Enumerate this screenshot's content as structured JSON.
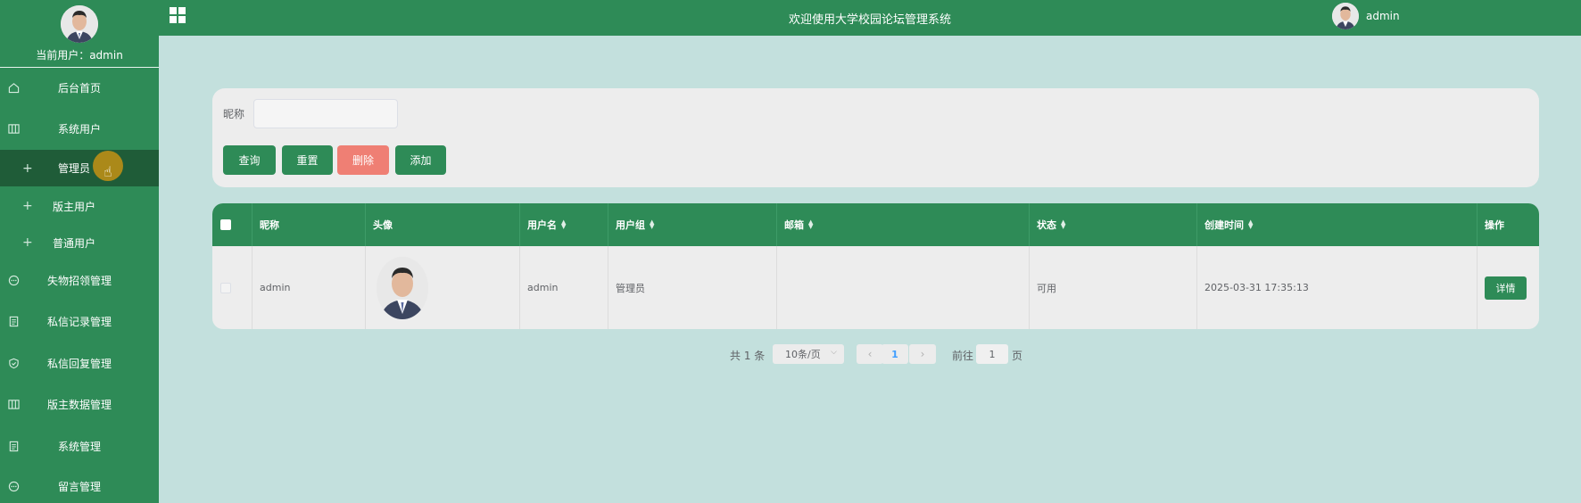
{
  "sidebar": {
    "current_user_label": "当前用户：",
    "current_user_name": "admin",
    "items": [
      {
        "label": "后台首页",
        "icon": "home-icon"
      },
      {
        "label": "系统用户",
        "icon": "columns-icon"
      },
      {
        "label": "管理员",
        "icon": "plus-icon",
        "active": true
      },
      {
        "label": "版主用户",
        "icon": "plus-icon"
      },
      {
        "label": "普通用户",
        "icon": "plus-icon"
      },
      {
        "label": "失物招领管理",
        "icon": "chat-icon"
      },
      {
        "label": "私信记录管理",
        "icon": "document-icon"
      },
      {
        "label": "私信回复管理",
        "icon": "shield-icon"
      },
      {
        "label": "版主数据管理",
        "icon": "columns-icon"
      },
      {
        "label": "系统管理",
        "icon": "document-icon"
      },
      {
        "label": "留言管理",
        "icon": "chat-icon"
      }
    ]
  },
  "header": {
    "title": "欢迎使用大学校园论坛管理系统",
    "username": "admin"
  },
  "search": {
    "nickname_label": "昵称",
    "nickname_value": "",
    "query_btn": "查询",
    "reset_btn": "重置",
    "delete_btn": "删除",
    "add_btn": "添加"
  },
  "table": {
    "columns": [
      "昵称",
      "头像",
      "用户名",
      "用户组",
      "邮箱",
      "状态",
      "创建时间",
      "操作"
    ],
    "rows": [
      {
        "nickname": "admin",
        "username": "admin",
        "group": "管理员",
        "email": "",
        "status": "可用",
        "created": "2025-03-31 17:35:13",
        "action": "详情"
      }
    ]
  },
  "pagination": {
    "total": "共 1 条",
    "page_size": "10条/页",
    "current_page": "1",
    "goto_label": "前往",
    "goto_value": "1",
    "goto_unit": "页"
  },
  "colors": {
    "primary": "#2e8b57",
    "danger": "#ef7f74",
    "background": "#c3e0dd"
  }
}
